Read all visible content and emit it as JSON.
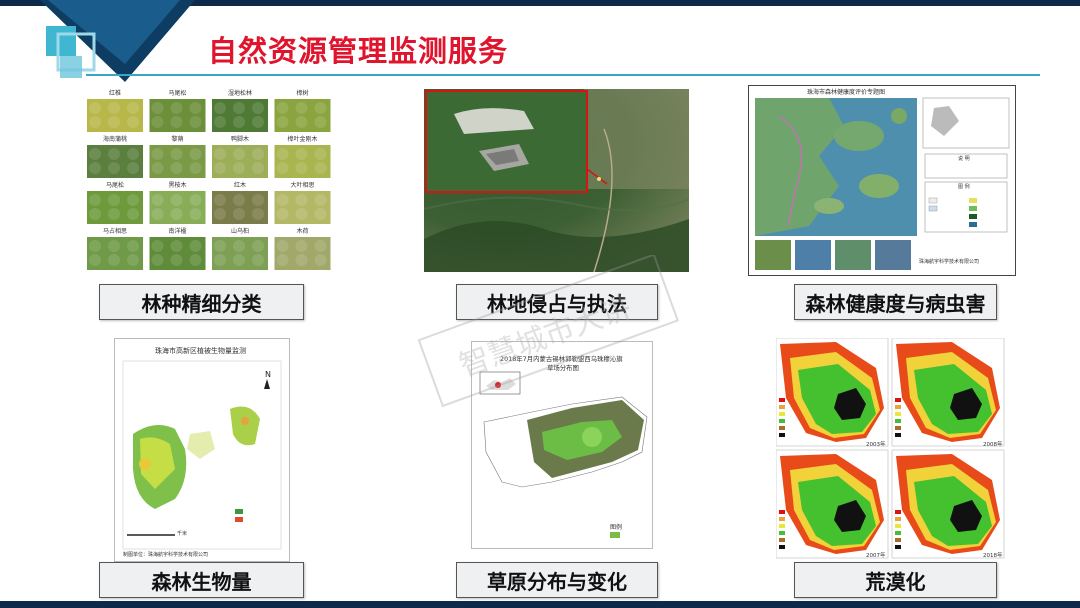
{
  "slide": {
    "title": "自然资源管理监测服务"
  },
  "panels": [
    {
      "label": "林种精细分类"
    },
    {
      "label": "林地侵占与执法"
    },
    {
      "label": "森林健康度与病虫害"
    },
    {
      "label": "森林生物量"
    },
    {
      "label": "草原分布与变化"
    },
    {
      "label": "荒漠化"
    }
  ],
  "species_grid": {
    "names": [
      "红椎",
      "马尾松",
      "湿地松林",
      "樟树",
      "海南蒲桃",
      "黎蒴",
      "鸭脚木",
      "樟叶金刚木",
      "马尾松",
      "黑桉木",
      "红木",
      "大叶相思",
      "马占相思",
      "南洋楹",
      "山乌桕",
      "木荷"
    ]
  },
  "forest_health_map": {
    "title": "珠海市森林健康度评价专题图",
    "legend_heading": "图 例",
    "note_heading": "说 明",
    "credit": "珠海航宇科学技术有限公司"
  },
  "biomass_map": {
    "title": "珠海市高新区植被生物量监测",
    "credit": "制图单位：珠海航宇科学技术有限公司",
    "scale_unit": "千米"
  },
  "grassland_map": {
    "title_line1": "2018年7月内蒙古锡林郭勒盟西乌珠穆沁旗",
    "title_line2": "草场分布图",
    "legend_heading": "图例"
  },
  "desert_maps": {
    "years": [
      "2003年",
      "2008年",
      "2007年",
      "2018年"
    ]
  },
  "watermark": {
    "text": "智慧城市大讲"
  },
  "colors": {
    "title": "#e0142c",
    "dark_bar": "#0d2a4a",
    "accent_teal": "#3aa6c4"
  }
}
